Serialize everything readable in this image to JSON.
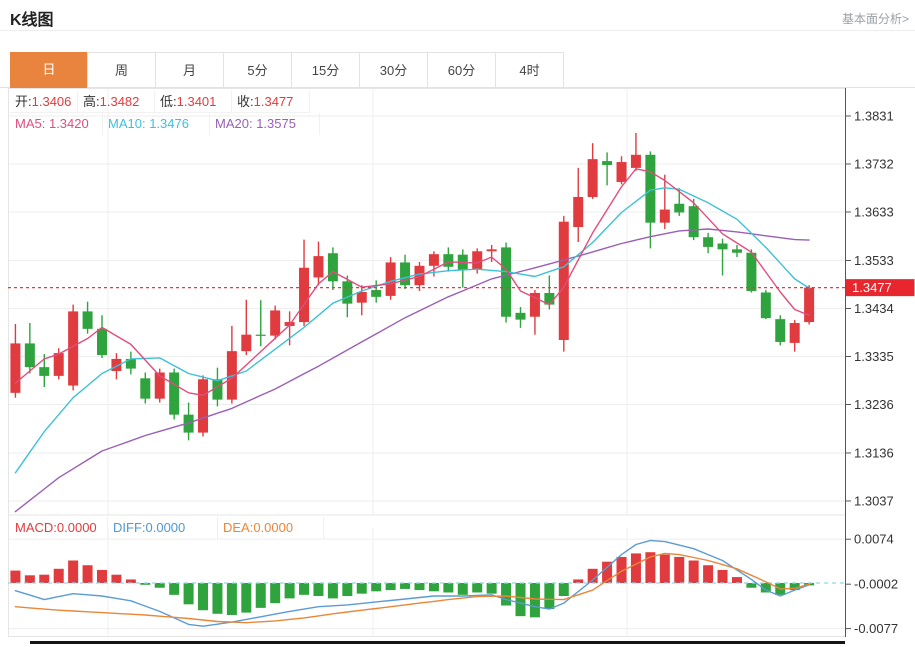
{
  "header": {
    "title": "K线图",
    "link": "基本面分析>"
  },
  "tabs": {
    "items": [
      "日",
      "周",
      "月",
      "5分",
      "15分",
      "30分",
      "60分",
      "4时"
    ],
    "active_index": 0
  },
  "ohlc": {
    "open_label": "开:",
    "open": "1.3406",
    "high_label": "高:",
    "high": "1.3482",
    "low_label": "低:",
    "low": "1.3401",
    "close_label": "收:",
    "close": "1.3477"
  },
  "ma": {
    "ma5_label": "MA5:",
    "ma5": "1.3420",
    "ma10_label": "MA10:",
    "ma10": "1.3476",
    "ma20_label": "MA20:",
    "ma20": "1.3575"
  },
  "macd_header": {
    "macd_label": "MACD:",
    "macd": "0.0000",
    "diff_label": "DIFF:",
    "diff": "0.0000",
    "dea_label": "DEA:",
    "dea": "0.0000"
  },
  "colors": {
    "up": "#e03b3e",
    "down": "#2fa33d",
    "ma5": "#e14d7d",
    "ma10": "#3ec0d8",
    "ma20": "#9a5fb5",
    "diff": "#5b9bd5",
    "dea": "#e8873a",
    "grid": "#eeeeee",
    "vgrid": "#efefef",
    "border": "#e5e5e5",
    "axis": "#555555",
    "dotted_price_line": "#e23b3c",
    "zero_dash_line": "#8fd8e8",
    "price_tag_bg": "#e8262d",
    "price_tag_text": "#ffffff",
    "active_tab_bg": "#e8843e",
    "axis_label": "#333333"
  },
  "chart_data": {
    "type": "candlestick",
    "title": "K线图",
    "legend": [
      "MA5",
      "MA10",
      "MA20",
      "MACD",
      "DIFF",
      "DEA"
    ],
    "grid": true,
    "last_price": "1.3477",
    "last_price_value": 1.3477,
    "panels": [
      {
        "type": "candlestick",
        "y_tick_labels": [
          "1.3831",
          "1.3732",
          "1.3633",
          "1.3533",
          "1.3434",
          "1.3335",
          "1.3236",
          "1.3136",
          "1.3037"
        ],
        "y_ticks": [
          1.3831,
          1.3732,
          1.3633,
          1.3533,
          1.3434,
          1.3335,
          1.3236,
          1.3136,
          1.3037
        ],
        "ylim": [
          1.3,
          1.387
        ],
        "candles_ohlc": [
          [
            1.326,
            1.3402,
            1.325,
            1.3362
          ],
          [
            1.3362,
            1.3404,
            1.33,
            1.3313
          ],
          [
            1.3313,
            1.334,
            1.3272,
            1.3295
          ],
          [
            1.3295,
            1.3352,
            1.3288,
            1.3342
          ],
          [
            1.3275,
            1.3442,
            1.3265,
            1.3428
          ],
          [
            1.3428,
            1.3448,
            1.3382,
            1.3392
          ],
          [
            1.3392,
            1.342,
            1.3332,
            1.3338
          ],
          [
            1.3305,
            1.3342,
            1.3288,
            1.333
          ],
          [
            1.333,
            1.3345,
            1.3298,
            1.331
          ],
          [
            1.329,
            1.3302,
            1.3238,
            1.3248
          ],
          [
            1.3248,
            1.331,
            1.324,
            1.3302
          ],
          [
            1.3302,
            1.331,
            1.3205,
            1.3215
          ],
          [
            1.3215,
            1.324,
            1.3162,
            1.3178
          ],
          [
            1.3178,
            1.3296,
            1.317,
            1.3288
          ],
          [
            1.3288,
            1.3312,
            1.3232,
            1.3246
          ],
          [
            1.3246,
            1.3398,
            1.3238,
            1.3346
          ],
          [
            1.3346,
            1.3452,
            1.3338,
            1.338
          ],
          [
            1.338,
            1.3451,
            1.3356,
            1.3378
          ],
          [
            1.3378,
            1.344,
            1.337,
            1.343
          ],
          [
            1.3398,
            1.3428,
            1.3358,
            1.3406
          ],
          [
            1.3406,
            1.3576,
            1.3398,
            1.3518
          ],
          [
            1.3498,
            1.3572,
            1.3482,
            1.3542
          ],
          [
            1.3548,
            1.356,
            1.3472,
            1.349
          ],
          [
            1.349,
            1.3502,
            1.3416,
            1.3444
          ],
          [
            1.3446,
            1.3482,
            1.342,
            1.3468
          ],
          [
            1.3472,
            1.3492,
            1.3446,
            1.3458
          ],
          [
            1.346,
            1.354,
            1.3452,
            1.3529
          ],
          [
            1.3529,
            1.3545,
            1.3474,
            1.3482
          ],
          [
            1.3482,
            1.353,
            1.347,
            1.3522
          ],
          [
            1.3522,
            1.3552,
            1.35,
            1.3546
          ],
          [
            1.3546,
            1.356,
            1.351,
            1.352
          ],
          [
            1.3545,
            1.3556,
            1.3477,
            1.3514
          ],
          [
            1.3514,
            1.3558,
            1.3506,
            1.3552
          ],
          [
            1.3552,
            1.3565,
            1.353,
            1.3556
          ],
          [
            1.356,
            1.357,
            1.3405,
            1.3417
          ],
          [
            1.3425,
            1.3437,
            1.3394,
            1.3411
          ],
          [
            1.3417,
            1.3472,
            1.338,
            1.3466
          ],
          [
            1.3466,
            1.3502,
            1.3432,
            1.3442
          ],
          [
            1.3369,
            1.3625,
            1.3345,
            1.3613
          ],
          [
            1.3602,
            1.3724,
            1.3571,
            1.3664
          ],
          [
            1.3664,
            1.3775,
            1.366,
            1.3742
          ],
          [
            1.3738,
            1.3756,
            1.3688,
            1.373
          ],
          [
            1.3695,
            1.3748,
            1.369,
            1.3736
          ],
          [
            1.3724,
            1.3796,
            1.3718,
            1.3751
          ],
          [
            1.3751,
            1.3758,
            1.3558,
            1.3611
          ],
          [
            1.3611,
            1.371,
            1.3598,
            1.3638
          ],
          [
            1.365,
            1.3682,
            1.3625,
            1.3632
          ],
          [
            1.3645,
            1.366,
            1.3575,
            1.3581
          ],
          [
            1.3581,
            1.359,
            1.3548,
            1.3561
          ],
          [
            1.3568,
            1.3578,
            1.3502,
            1.3556
          ],
          [
            1.3556,
            1.3565,
            1.354,
            1.3549
          ],
          [
            1.3549,
            1.3556,
            1.3467,
            1.347
          ],
          [
            1.3467,
            1.3472,
            1.3412,
            1.3414
          ],
          [
            1.3412,
            1.342,
            1.3358,
            1.3365
          ],
          [
            1.3363,
            1.341,
            1.3345,
            1.3404
          ],
          [
            1.3406,
            1.3482,
            1.3401,
            1.3477
          ]
        ],
        "ma5_anchors": [
          [
            0,
            1.328
          ],
          [
            2,
            1.333
          ],
          [
            3,
            1.334
          ],
          [
            5,
            1.3372
          ],
          [
            6,
            1.3395
          ],
          [
            8,
            1.336
          ],
          [
            10,
            1.3295
          ],
          [
            12,
            1.326
          ],
          [
            13,
            1.3255
          ],
          [
            15,
            1.329
          ],
          [
            17,
            1.3345
          ],
          [
            19,
            1.34
          ],
          [
            21,
            1.3485
          ],
          [
            22,
            1.351
          ],
          [
            24,
            1.3478
          ],
          [
            26,
            1.3485
          ],
          [
            28,
            1.35
          ],
          [
            30,
            1.353
          ],
          [
            32,
            1.3528
          ],
          [
            33,
            1.354
          ],
          [
            34,
            1.3515
          ],
          [
            35,
            1.347
          ],
          [
            37,
            1.3442
          ],
          [
            38,
            1.3478
          ],
          [
            40,
            1.359
          ],
          [
            42,
            1.3685
          ],
          [
            43,
            1.3722
          ],
          [
            44,
            1.3716
          ],
          [
            45,
            1.3698
          ],
          [
            47,
            1.3652
          ],
          [
            49,
            1.3588
          ],
          [
            51,
            1.355
          ],
          [
            53,
            1.3468
          ],
          [
            54,
            1.3432
          ],
          [
            55,
            1.342
          ]
        ],
        "ma10_anchors": [
          [
            0,
            1.3095
          ],
          [
            2,
            1.318
          ],
          [
            4,
            1.325
          ],
          [
            6,
            1.33
          ],
          [
            8,
            1.333
          ],
          [
            10,
            1.3332
          ],
          [
            12,
            1.33
          ],
          [
            14,
            1.3285
          ],
          [
            16,
            1.3305
          ],
          [
            18,
            1.335
          ],
          [
            20,
            1.3395
          ],
          [
            22,
            1.3445
          ],
          [
            24,
            1.347
          ],
          [
            26,
            1.349
          ],
          [
            28,
            1.3505
          ],
          [
            30,
            1.3512
          ],
          [
            32,
            1.3515
          ],
          [
            34,
            1.351
          ],
          [
            36,
            1.35
          ],
          [
            38,
            1.352
          ],
          [
            40,
            1.357
          ],
          [
            42,
            1.3632
          ],
          [
            44,
            1.3678
          ],
          [
            45,
            1.3683
          ],
          [
            46,
            1.368
          ],
          [
            48,
            1.3652
          ],
          [
            50,
            1.3618
          ],
          [
            52,
            1.356
          ],
          [
            54,
            1.3495
          ],
          [
            55,
            1.3476
          ]
        ],
        "ma20_anchors": [
          [
            0,
            1.3015
          ],
          [
            3,
            1.3085
          ],
          [
            6,
            1.314
          ],
          [
            9,
            1.3172
          ],
          [
            12,
            1.3198
          ],
          [
            15,
            1.3228
          ],
          [
            18,
            1.3268
          ],
          [
            21,
            1.3315
          ],
          [
            24,
            1.3365
          ],
          [
            27,
            1.3415
          ],
          [
            30,
            1.3458
          ],
          [
            33,
            1.3495
          ],
          [
            36,
            1.3518
          ],
          [
            39,
            1.3542
          ],
          [
            42,
            1.3568
          ],
          [
            44,
            1.3582
          ],
          [
            46,
            1.3594
          ],
          [
            48,
            1.3598
          ],
          [
            50,
            1.3592
          ],
          [
            52,
            1.3584
          ],
          [
            54,
            1.3576
          ],
          [
            55,
            1.3575
          ]
        ]
      },
      {
        "type": "macd",
        "y_tick_labels": [
          "0.0074",
          "-0.0002",
          "-0.0077"
        ],
        "y_ticks": [
          0.0074,
          -0.0002,
          -0.0077
        ],
        "histogram": [
          0.0021,
          0.0013,
          0.0014,
          0.0024,
          0.0038,
          0.003,
          0.0022,
          0.0014,
          0.0006,
          -0.0003,
          -0.0008,
          -0.002,
          -0.0036,
          -0.0046,
          -0.0052,
          -0.0054,
          -0.005,
          -0.0042,
          -0.0034,
          -0.0026,
          -0.002,
          -0.0022,
          -0.0026,
          -0.0022,
          -0.0018,
          -0.0014,
          -0.0012,
          -0.001,
          -0.0012,
          -0.0014,
          -0.0016,
          -0.002,
          -0.0016,
          -0.0018,
          -0.0038,
          -0.0056,
          -0.0058,
          -0.0044,
          -0.0022,
          0.0006,
          0.0024,
          0.0036,
          0.0044,
          0.005,
          0.0052,
          0.0048,
          0.0044,
          0.0038,
          0.003,
          0.0022,
          0.001,
          -0.0008,
          -0.0016,
          -0.002,
          -0.0012,
          -0.0004
        ],
        "diff_anchors": [
          [
            0,
            -0.0013
          ],
          [
            2,
            -0.0028
          ],
          [
            4,
            -0.0018
          ],
          [
            6,
            -0.0022
          ],
          [
            8,
            -0.003
          ],
          [
            10,
            -0.0048
          ],
          [
            12,
            -0.007
          ],
          [
            13,
            -0.0073
          ],
          [
            15,
            -0.0066
          ],
          [
            17,
            -0.0057
          ],
          [
            19,
            -0.0048
          ],
          [
            21,
            -0.004
          ],
          [
            23,
            -0.0037
          ],
          [
            25,
            -0.0032
          ],
          [
            27,
            -0.0027
          ],
          [
            29,
            -0.0022
          ],
          [
            31,
            -0.0022
          ],
          [
            33,
            -0.002
          ],
          [
            34,
            -0.0028
          ],
          [
            36,
            -0.004
          ],
          [
            37,
            -0.0044
          ],
          [
            38,
            -0.0034
          ],
          [
            40,
            0.0005
          ],
          [
            42,
            0.0048
          ],
          [
            43,
            0.0065
          ],
          [
            44,
            0.0072
          ],
          [
            45,
            0.007
          ],
          [
            47,
            0.0058
          ],
          [
            49,
            0.0038
          ],
          [
            51,
            0.0006
          ],
          [
            52,
            -0.0012
          ],
          [
            53,
            -0.0022
          ],
          [
            54,
            -0.0012
          ],
          [
            55,
            -0.0003
          ]
        ],
        "dea_anchors": [
          [
            0,
            -0.004
          ],
          [
            3,
            -0.0046
          ],
          [
            6,
            -0.005
          ],
          [
            9,
            -0.0054
          ],
          [
            12,
            -0.006
          ],
          [
            14,
            -0.0065
          ],
          [
            16,
            -0.0067
          ],
          [
            18,
            -0.0064
          ],
          [
            20,
            -0.0059
          ],
          [
            22,
            -0.0052
          ],
          [
            24,
            -0.0046
          ],
          [
            26,
            -0.004
          ],
          [
            28,
            -0.0034
          ],
          [
            30,
            -0.0028
          ],
          [
            32,
            -0.0023
          ],
          [
            34,
            -0.0022
          ],
          [
            36,
            -0.0027
          ],
          [
            38,
            -0.0028
          ],
          [
            40,
            -0.0012
          ],
          [
            42,
            0.002
          ],
          [
            44,
            0.0044
          ],
          [
            45,
            0.005
          ],
          [
            46,
            0.0048
          ],
          [
            48,
            0.0038
          ],
          [
            50,
            0.0024
          ],
          [
            52,
            0.0002
          ],
          [
            53,
            -0.001
          ],
          [
            54,
            -0.0009
          ],
          [
            55,
            -0.0002
          ]
        ]
      }
    ]
  }
}
